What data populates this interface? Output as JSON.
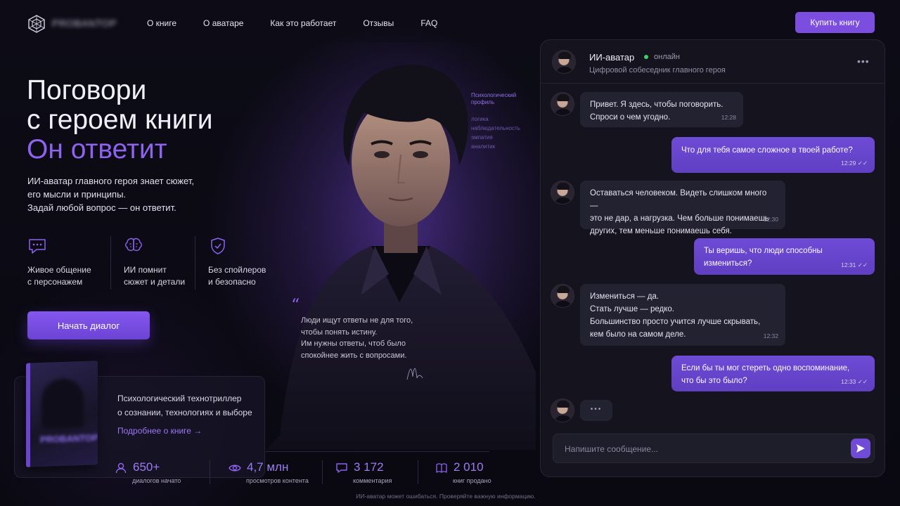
{
  "header": {
    "brand": "PROBANTOP",
    "nav": [
      "О книге",
      "О аватаре",
      "Как это работает",
      "Отзывы",
      "FAQ"
    ],
    "buy_label": "Купить книгу"
  },
  "hero": {
    "title_line1": "Поговори",
    "title_line2": "с героем книги",
    "accent": "Он ответит",
    "desc_lines": [
      "ИИ-аватар главного героя знает сюжет,",
      "его мысли и принципы.",
      "Задай любой вопрос — он ответит."
    ],
    "features": [
      {
        "icon": "chat-bubble-icon",
        "lines": [
          "Живое общение",
          "с персонажем"
        ]
      },
      {
        "icon": "brain-icon",
        "lines": [
          "ИИ помнит",
          "сюжет и детали"
        ]
      },
      {
        "icon": "shield-check-icon",
        "lines": [
          "Без спойлеров",
          "и безопасно"
        ]
      }
    ],
    "start_label": "Начать диалог"
  },
  "portrait": {
    "profile_title_lines": [
      "Психологический",
      "профиль"
    ],
    "profile_items": [
      "логика",
      "наблюдательность",
      "эмпатия",
      "аналитик"
    ],
    "quote_lines": [
      "Люди ищут ответы не для того,",
      "чтобы понять истину.",
      "Им нужны ответы, чтоб было",
      "спокойнее жить с вопросами."
    ]
  },
  "book": {
    "cover_title": "PROBANTOP",
    "desc_lines": [
      "Психологический технотриллер",
      "о сознании, технологиях и выборе"
    ],
    "link_label": "Подробнее о книге →"
  },
  "stats": [
    {
      "icon": "user-icon",
      "value": "650+",
      "label": "диалогов начато"
    },
    {
      "icon": "eye-icon",
      "value": "4,7 млн",
      "label": "просмотров контента"
    },
    {
      "icon": "comment-icon",
      "value": "3 172",
      "label": "комментария"
    },
    {
      "icon": "book-icon",
      "value": "2 010",
      "label": "книг продано"
    }
  ],
  "footnote": "ИИ-аватар может ошибаться. Проверяйте важную информацию.",
  "chat": {
    "name": "ИИ-аватар",
    "status": "онлайн",
    "subtitle": "Цифровой собеседник главного героя",
    "more": "•••",
    "messages": [
      {
        "dir": "in",
        "lines": [
          "Привет. Я здесь, чтобы поговорить.",
          "Спроси о чем угодно."
        ],
        "time": "12:28"
      },
      {
        "dir": "out",
        "lines": [
          "Что для тебя самое сложное в твоей работе?"
        ],
        "time": "12:29 ✓✓"
      },
      {
        "dir": "in",
        "lines": [
          "Оставаться человеком. Видеть слишком много —",
          "это не дар, а нагрузка. Чем больше понимаешь",
          "других, тем меньше понимаешь себя."
        ],
        "time": "12:30"
      },
      {
        "dir": "out",
        "lines": [
          "Ты веришь, что люди способны",
          "измениться?"
        ],
        "time": "12:31 ✓✓"
      },
      {
        "dir": "in",
        "lines": [
          "Измениться — да.",
          "Стать лучше — редко.",
          "Большинство просто учится лучше скрывать,",
          "кем было на самом деле."
        ],
        "time": "12:32"
      },
      {
        "dir": "out",
        "lines": [
          "Если бы ты мог стереть одно воспоминание,",
          "что бы это было?"
        ],
        "time": "12:33 ✓✓"
      }
    ],
    "typing": "•••",
    "placeholder": "Напишите сообщение..."
  },
  "colors": {
    "accent": "#7b4ee0",
    "accent_text": "#8d63f0",
    "online": "#3ecf6b",
    "bg": "#0b0a12"
  }
}
